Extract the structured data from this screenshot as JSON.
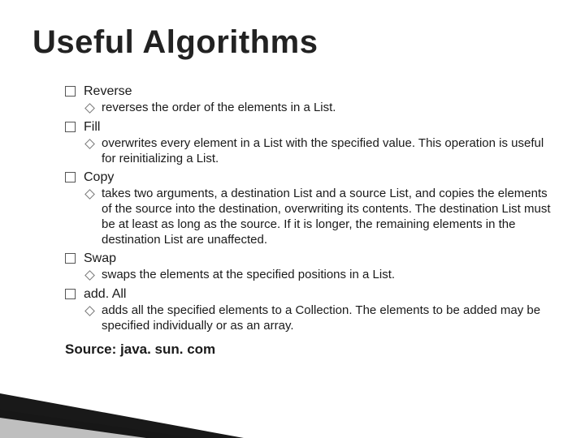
{
  "title": "Useful Algorithms",
  "items": [
    {
      "label": "Reverse",
      "desc": "reverses the order of the elements in a List."
    },
    {
      "label": "Fill",
      "desc": " overwrites every element in a List with the specified value. This operation is useful for reinitializing a List."
    },
    {
      "label": "Copy",
      "desc": "takes two arguments, a destination List and a source List, and copies the elements of the source into the destination, overwriting its contents. The destination List must be at least as long as the source. If it is longer, the remaining elements in the destination List are unaffected."
    },
    {
      "label": "Swap",
      "desc": "swaps the elements at the specified positions in a List."
    },
    {
      "label": "add. All",
      "desc": "adds all the specified elements to a Collection. The elements to be added may be specified individually or as an array."
    }
  ],
  "source": "Source: java. sun. com"
}
